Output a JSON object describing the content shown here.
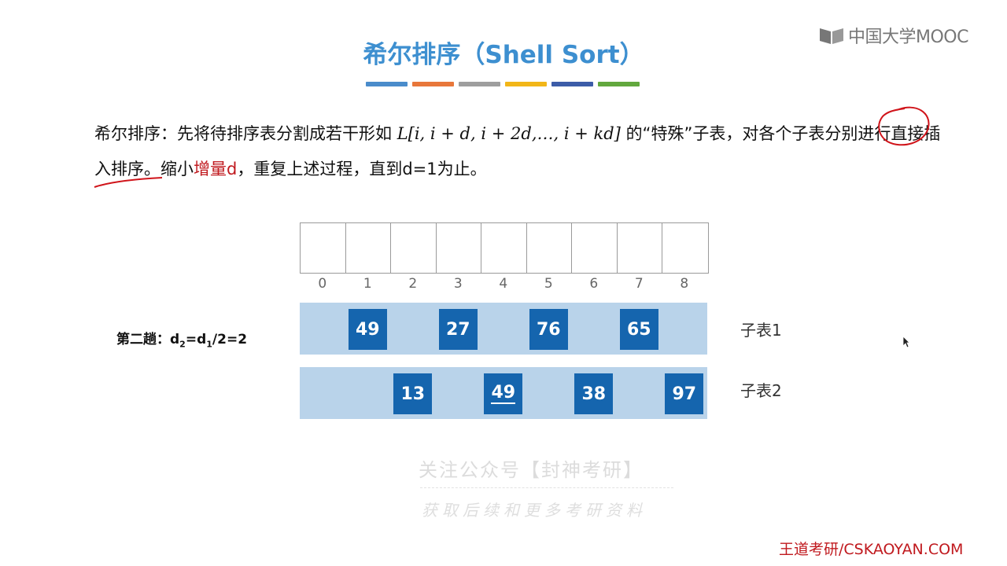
{
  "logo": {
    "text": "中国大学MOOC",
    "icon": "mooc-book-icon"
  },
  "slide": {
    "title": "希尔排序（Shell Sort）",
    "title_bar_colors": [
      "#4a8ccb",
      "#e8773a",
      "#9e9e9e",
      "#f2b618",
      "#3c5ca8",
      "#62a83e"
    ],
    "para": {
      "p1": "希尔排序：先将待排序表分割成若干形如",
      "math": "L[i, i + d, i + 2d,…, i + kd]",
      "p2": "的“特殊”子表，对各个子表分别进行直接插入排序。缩小",
      "highlight": "增量d",
      "p3": "，重复上述过程，直到d=1为止。"
    }
  },
  "diagram": {
    "indices": [
      "0",
      "1",
      "2",
      "3",
      "4",
      "5",
      "6",
      "7",
      "8"
    ],
    "pass_label": {
      "prefix": "第二趟：d",
      "sub1": "2",
      "mid": "=d",
      "sub2": "1",
      "suffix": "/2=2"
    },
    "sublist1": {
      "label": "子表1",
      "values": [
        "49",
        "27",
        "76",
        "65"
      ]
    },
    "sublist2": {
      "label": "子表2",
      "values": [
        "13",
        "49",
        "38",
        "97"
      ]
    }
  },
  "watermark": {
    "line1": "关注公众号【封神考研】",
    "line2": "获取后续和更多考研资料"
  },
  "footer": "王道考研/CSKAOYAN.COM",
  "colors": {
    "title": "#3d8fd0",
    "box": "#1565ae",
    "band": "#b9d3ea",
    "highlight": "#c0191e",
    "footer": "#c0191e"
  }
}
